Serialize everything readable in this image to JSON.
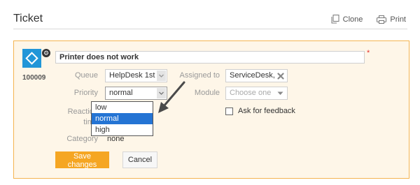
{
  "header": {
    "title": "Ticket",
    "clone_label": "Clone",
    "print_label": "Print"
  },
  "ticket": {
    "number": "100009",
    "subject": "Printer does not work",
    "required_mark": "*"
  },
  "form": {
    "queue_label": "Queue",
    "queue_value": "HelpDesk 1st",
    "assigned_label": "Assigned to",
    "assigned_value": "ServiceDesk,",
    "priority_label": "Priority",
    "priority_value": "normal",
    "module_label": "Module",
    "module_placeholder": "Choose one",
    "reaction_label_1": "Reaction",
    "reaction_label_2": "time",
    "category_label": "Category",
    "category_value": "none",
    "feedback_label": "Ask for feedback"
  },
  "priority_dropdown": {
    "options": [
      "low",
      "normal",
      "high"
    ],
    "selected": "normal"
  },
  "buttons": {
    "save": "Save changes",
    "cancel": "Cancel"
  },
  "colors": {
    "accent": "#f5a623",
    "card_bg": "#fef6e8",
    "selected": "#2474d4",
    "logo": "#2196d8"
  }
}
